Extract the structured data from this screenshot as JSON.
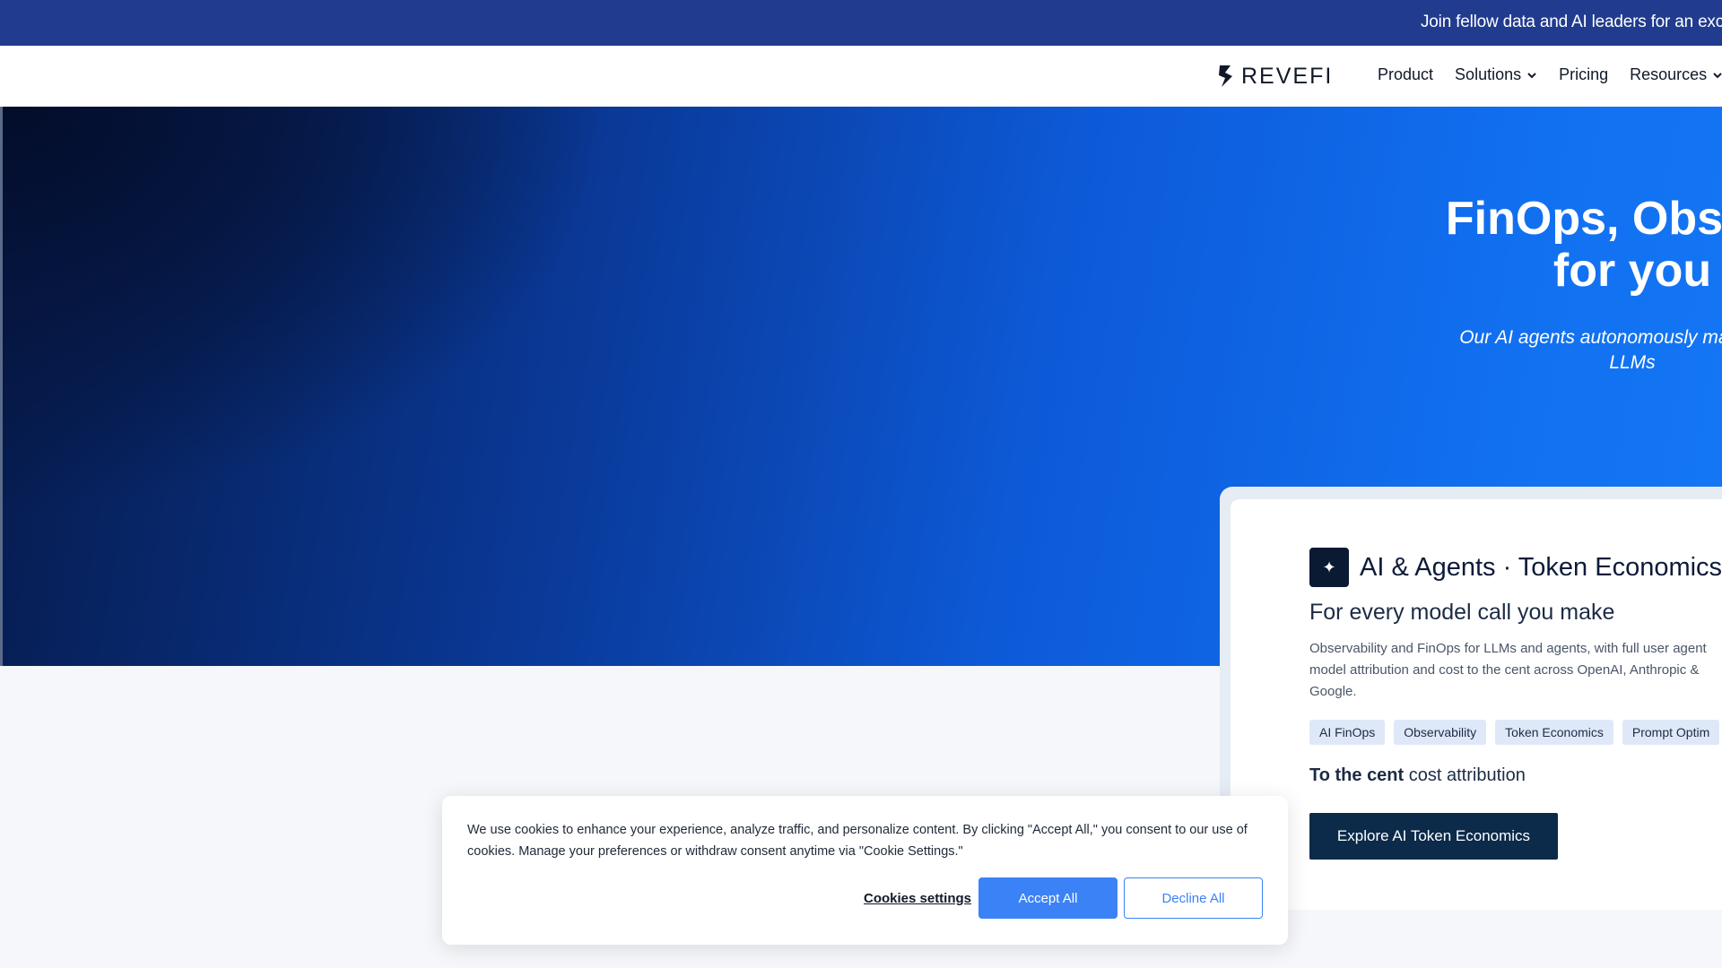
{
  "announcement": {
    "text": "Join fellow data and AI leaders for an exc"
  },
  "header": {
    "logo_text": "REVEFI",
    "nav": [
      {
        "label": "Product",
        "has_dropdown": false
      },
      {
        "label": "Solutions",
        "has_dropdown": true
      },
      {
        "label": "Pricing",
        "has_dropdown": false
      },
      {
        "label": "Resources",
        "has_dropdown": true
      }
    ]
  },
  "hero": {
    "title_line1": "FinOps, Observa",
    "title_line2": "for you",
    "subtitle_line1": "Our AI agents autonomously manage cos",
    "subtitle_line2": "LLMs"
  },
  "card": {
    "icon": "sparkle-icon",
    "title": "AI & Agents · Token Economics",
    "subtitle": "For every model call you make",
    "description": "Observability and FinOps for LLMs and agents, with full user agent model attribution and cost to the cent across OpenAI, Anthropic & Google.",
    "tags": [
      "AI FinOps",
      "Observability",
      "Token Economics",
      "Prompt Optim"
    ],
    "highlight_bold": "To the cent",
    "highlight_rest": " cost attribution",
    "cta": "Explore AI Token Economics"
  },
  "cookie": {
    "text": "We use cookies to enhance your experience, analyze traffic, and personalize content. By clicking \"Accept All,\" you consent to our use of cookies. Manage your preferences or withdraw consent anytime via \"Cookie Settings.\"",
    "settings_label": "Cookies settings",
    "accept_label": "Accept All",
    "decline_label": "Decline All"
  },
  "colors": {
    "announce_bg": "#213b8e",
    "cta_bg": "#0c2a4a",
    "accept_bg": "#3b82f6"
  }
}
